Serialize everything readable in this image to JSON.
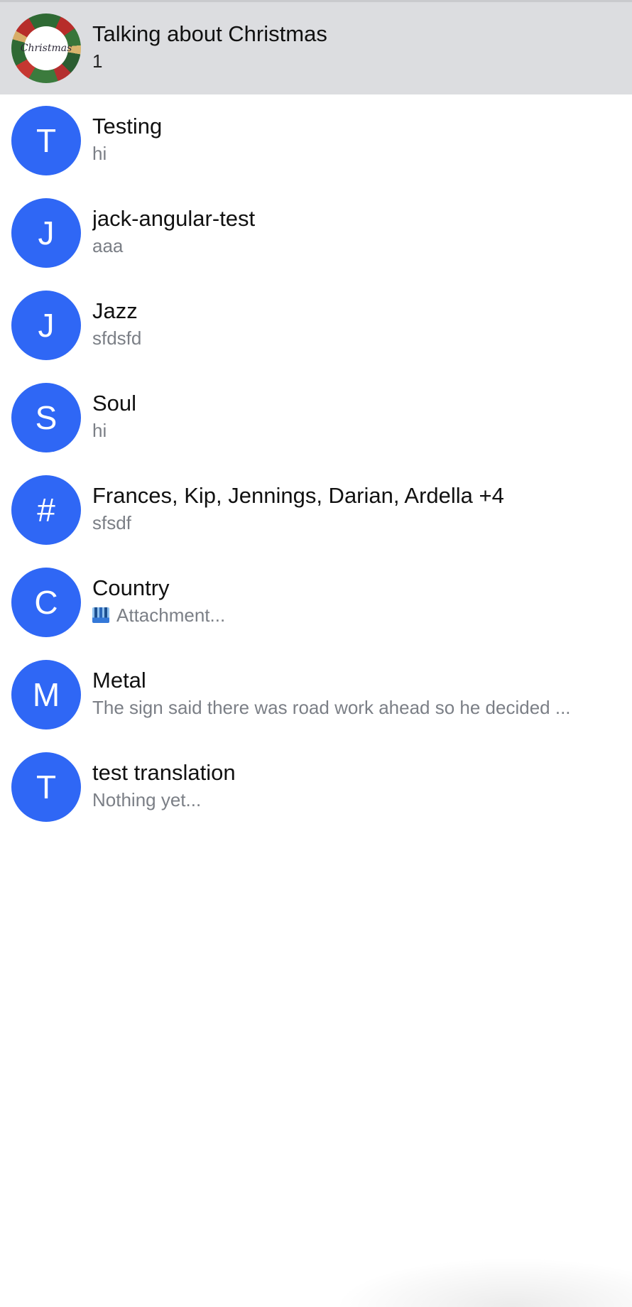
{
  "channels": [
    {
      "name": "Talking about Christmas",
      "preview": "1",
      "avatar": "",
      "avatar_label": "Christmas",
      "active": true,
      "avatar_type": "image"
    },
    {
      "name": "Testing",
      "preview": "hi",
      "avatar": "T",
      "avatar_type": "initial"
    },
    {
      "name": "jack-angular-test",
      "preview": "aaa",
      "avatar": "J",
      "avatar_type": "initial"
    },
    {
      "name": "Jazz",
      "preview": "sfdsfd",
      "avatar": "J",
      "avatar_type": "initial"
    },
    {
      "name": "Soul",
      "preview": "hi",
      "avatar": "S",
      "avatar_type": "initial"
    },
    {
      "name": "Frances, Kip, Jennings, Darian, Ardella +4",
      "preview": "sfsdf",
      "avatar": "#",
      "avatar_type": "initial"
    },
    {
      "name": "Country",
      "preview": "Attachment...",
      "avatar": "C",
      "avatar_type": "initial",
      "preview_icon": "image-attachment-icon"
    },
    {
      "name": "Metal",
      "preview": "The sign said there was road work ahead so he decided ...",
      "avatar": "M",
      "avatar_type": "initial"
    },
    {
      "name": "test translation",
      "preview": "Nothing yet...",
      "avatar": "T",
      "avatar_type": "initial"
    }
  ],
  "colors": {
    "avatar_blue": "#2f67f5",
    "active_row": "#dcdde0",
    "preview_text": "#7b7f86"
  }
}
